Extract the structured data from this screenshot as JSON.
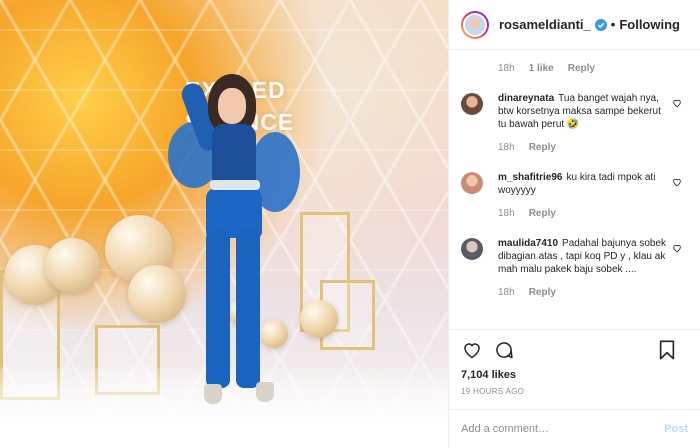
{
  "post": {
    "author": "rosameldianti_",
    "follow_status": "Following",
    "photo_sign_text": "EXCEED\nSCIENCE",
    "top_meta": {
      "time": "18h",
      "likes": "1 like",
      "reply": "Reply"
    },
    "comments": [
      {
        "username": "dinareynata",
        "text": "Tua banget wajah nya, btw korsetnya maksa sampe bekerut tu bawah perut 🤣",
        "time": "18h",
        "reply": "Reply",
        "avatar_color": "#6a4a3c"
      },
      {
        "username": "m_shafitrie96",
        "text": "ku kira tadi mpok ati woyyyyy",
        "time": "18h",
        "reply": "Reply",
        "avatar_color": "#c98c7c"
      },
      {
        "username": "maulida7410",
        "text": "Padahal bajunya sobek dibagian atas , tapi koq PD y , klau ak mah malu pakek baju sobek ....",
        "time": "18h",
        "reply": "Reply",
        "avatar_color": "#5a5a66"
      }
    ],
    "likes": "7,104 likes",
    "time_ago": "19 HOURS AGO",
    "add_comment_placeholder": "Add a comment…",
    "post_label": "Post"
  },
  "icons": {
    "verified": "verified-badge-icon",
    "heart": "heart-icon",
    "comment": "comment-icon",
    "bookmark": "bookmark-icon"
  },
  "colors": {
    "verified": "#3897f0",
    "post_button": "#b2dffc",
    "muted": "#8e8e8e"
  }
}
